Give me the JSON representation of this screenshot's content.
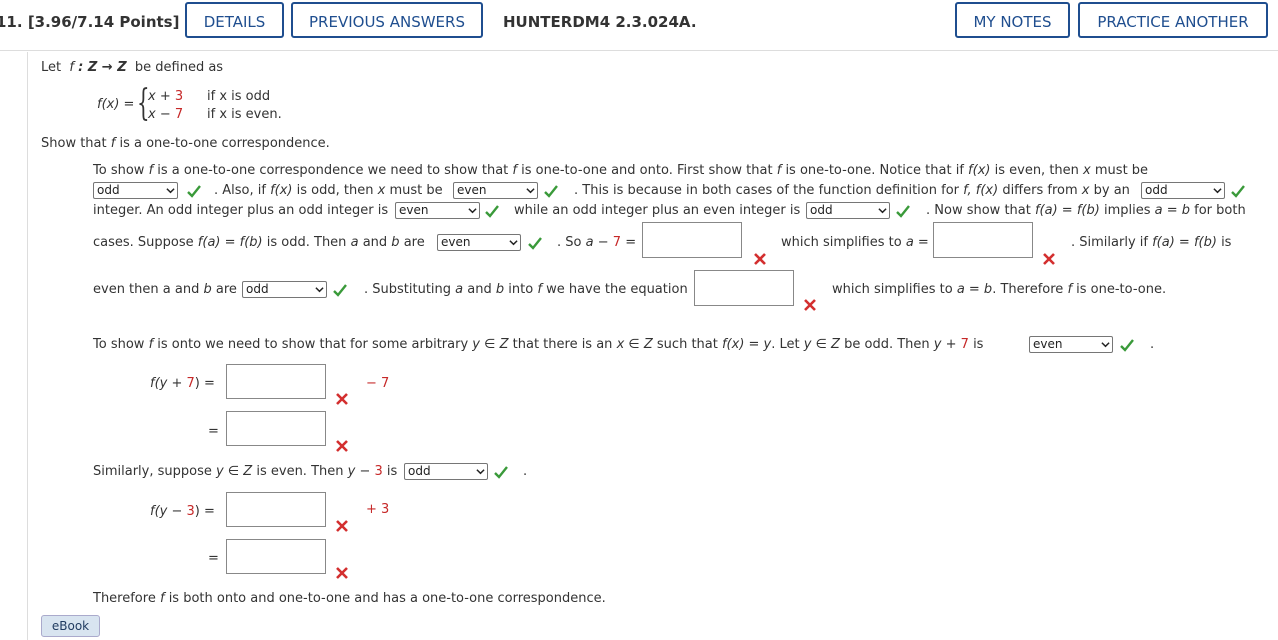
{
  "header": {
    "question_number": "11.",
    "points": "[3.96/7.14 Points]",
    "details_btn": "DETAILS",
    "prev_answers_btn": "PREVIOUS ANSWERS",
    "question_id": "HUNTERDM4 2.3.024A.",
    "my_notes_btn": "MY NOTES",
    "practice_btn": "PRACTICE ANOTHER"
  },
  "problem": {
    "let_prefix": "Let",
    "let_func": "f",
    "let_map": ": Z → Z",
    "let_suffix": "be defined as",
    "fx_label": "f(x) =",
    "case1_pre": "x +",
    "case1_num": "3",
    "case1_cond": "if x is odd",
    "case2_pre": "x −",
    "case2_num": "7",
    "case2_cond": "if x is even",
    "period": ".",
    "show_pre": "Show that",
    "show_f": "f",
    "show_post": "is a one-to-one correspondence."
  },
  "body": {
    "l1a": "To show",
    "l1b": "f",
    "l1c": "is a one-to-one correspondence we need to show that",
    "l1d": "f",
    "l1e": "is one-to-one and onto. First show that",
    "l1f": "f",
    "l1g": "is one-to-one. Notice that if",
    "l1h": "f(x)",
    "l1i": "is even, then",
    "l1j": "x",
    "l1k": "must be",
    "l2a": ". Also, if",
    "l2b": "f(x)",
    "l2c": "is odd, then",
    "l2d": "x",
    "l2e": "must be",
    "l2f": ". This is because in both cases of the function definition for",
    "l2g": "f, f(x)",
    "l2h": "differs from",
    "l2i": "x",
    "l2j": "by an",
    "l3a": "integer. An odd integer plus an odd integer is",
    "l3b": "while an odd integer plus an even integer is",
    "l3c": ". Now show that",
    "l3d": "f(a) = f(b)",
    "l3e": "implies",
    "l3f": "a = b",
    "l3g": "for both",
    "l4a": "cases. Suppose",
    "l4b": "f(a) = f(b)",
    "l4c": "is odd. Then",
    "l4d": "a",
    "l4e": "and",
    "l4f": "b",
    "l4g": "are",
    "l4h": ". So",
    "l4i": "a −",
    "l4j": "7",
    "l4k": "=",
    "l4l": "which simplifies to",
    "l4m": "a =",
    "l4n": ". Similarly if",
    "l4o": "f(a) = f(b)",
    "l4p": "is",
    "l5a": "even then a and",
    "l5b": "b",
    "l5c": "are",
    "l5d": ". Substituting",
    "l5e": "a",
    "l5f": "and",
    "l5g": "b",
    "l5h": "into",
    "l5i": "f",
    "l5j": "we have the equation",
    "l5k": "which simplifies to",
    "l5l": "a = b",
    "l5m": ". Therefore",
    "l5n": "f",
    "l5o": "is one-to-one.",
    "l6a": "To show",
    "l6b": "f",
    "l6c": "is onto we need to show that for some arbitrary",
    "l6d": "y ∈ Z",
    "l6e": "that there is an",
    "l6f": "x ∈ Z",
    "l6g": "such that",
    "l6h": "f(x) = y",
    "l6i": ". Let",
    "l6j": "y ∈ Z",
    "l6k": "be odd. Then",
    "l6l": "y +",
    "l6m": "7",
    "l6n": "is",
    "l6o": ".",
    "eq1a": "f(y +",
    "eq1b": "7",
    "eq1c": ") =",
    "eq1d": "− 7",
    "eq2": "=",
    "l7a": "Similarly, suppose",
    "l7b": "y ∈ Z",
    "l7c": "is even. Then",
    "l7d": "y −",
    "l7e": "3",
    "l7f": "is",
    "l7g": ".",
    "eq3a": "f(y −",
    "eq3b": "3",
    "eq3c": ") =",
    "eq3d": "+ 3",
    "eq4": "=",
    "l8": "Therefore",
    "l8b": "f",
    "l8c": "is both onto and one-to-one and has a one-to-one correspondence."
  },
  "selects": {
    "s1": "odd",
    "s2": "even",
    "s3": "odd",
    "s4": "even",
    "s5": "odd",
    "s6": "even",
    "s7": "odd",
    "s8": "even",
    "s9": "odd"
  },
  "ebook_btn": "eBook",
  "colors": {
    "accent": "#1f4e8f",
    "correct": "#3a9a3a",
    "incorrect": "#d32f2f",
    "red_text": "#c62828"
  }
}
